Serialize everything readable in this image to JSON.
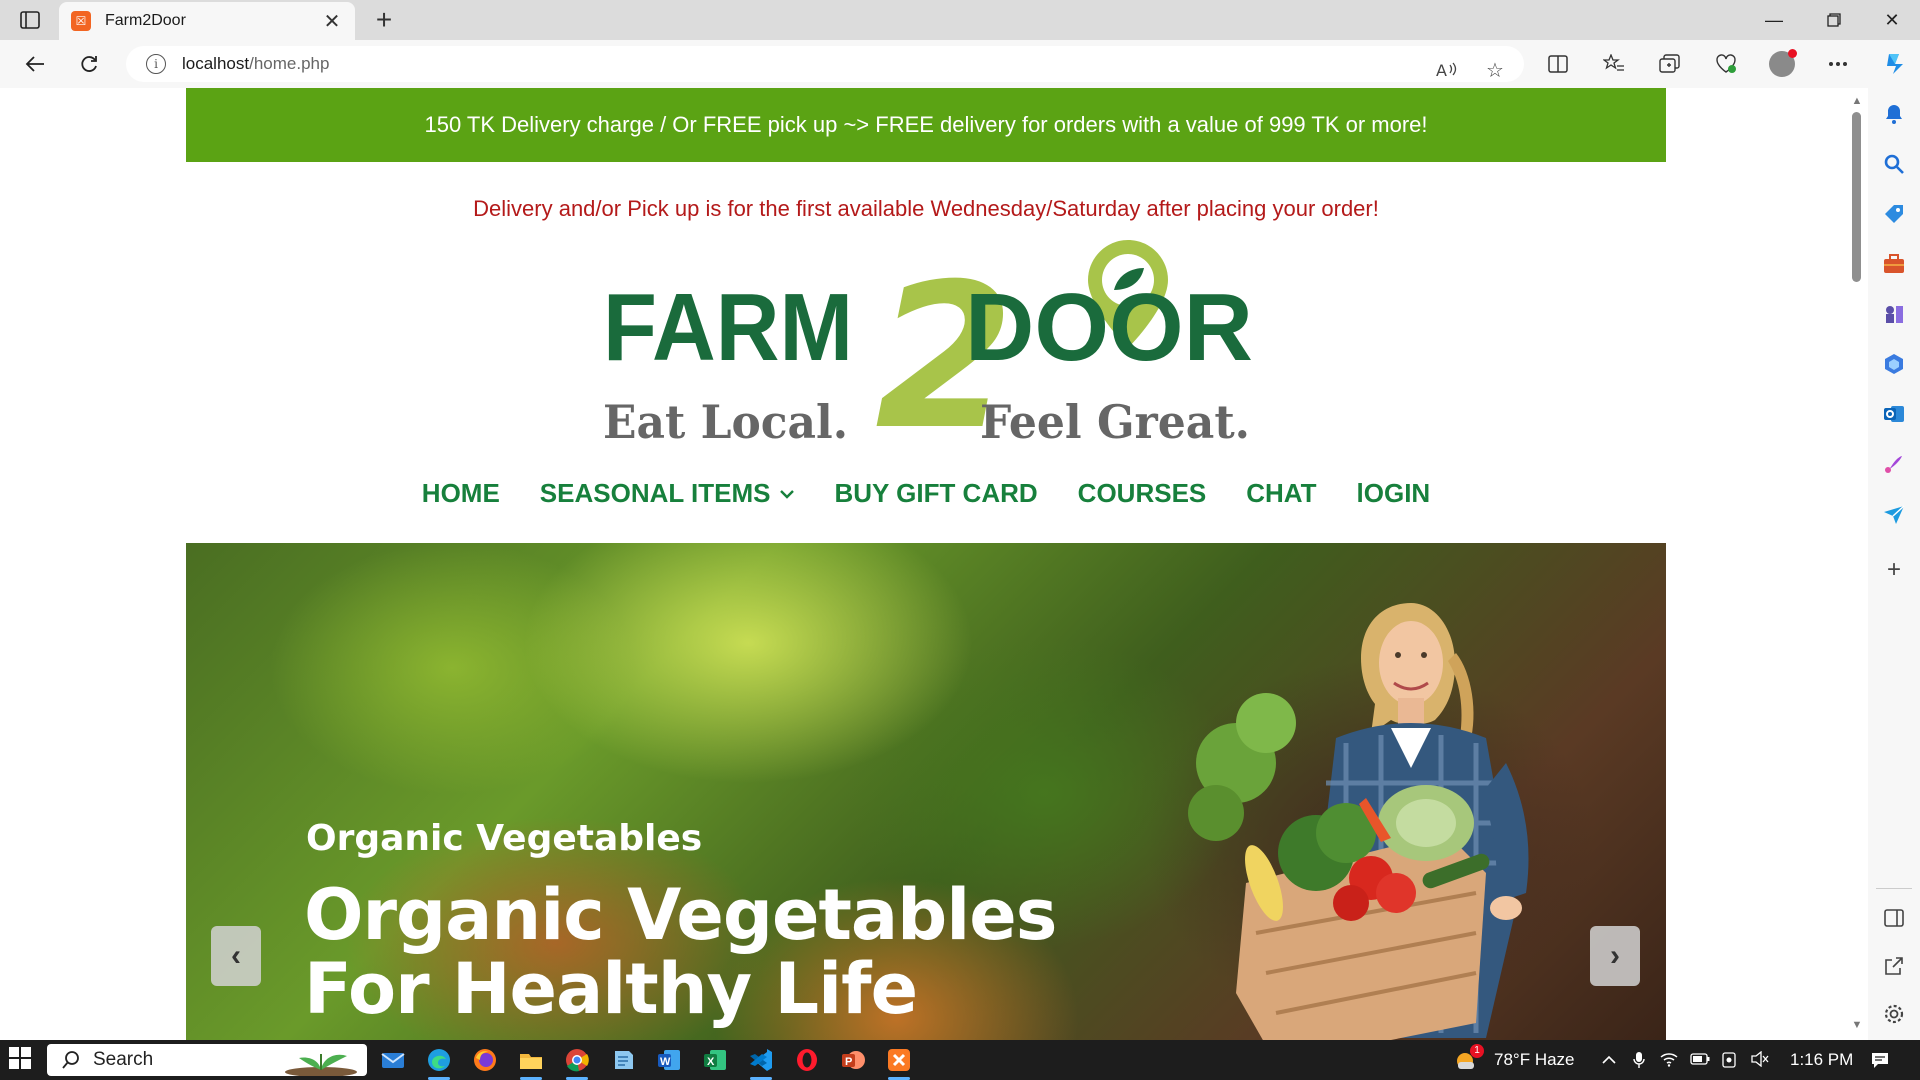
{
  "browser": {
    "tab_title": "Farm2Door",
    "url_host": "localhost",
    "url_path": "/home.php"
  },
  "page": {
    "promo": "150 TK Delivery charge / Or FREE pick up ~> FREE delivery for orders with a value of 999 TK or more!",
    "notice": "Delivery and/or Pick up is for the first available Wednesday/Saturday after placing your order!",
    "logo": {
      "word_left": "FARM",
      "digit": "2",
      "word_right": "DOOR",
      "tagline_left": "Eat Local.",
      "tagline_right": "Feel Great."
    },
    "nav": [
      {
        "label": "HOME"
      },
      {
        "label": "SEASONAL ITEMS"
      },
      {
        "label": "BUY GIFT CARD"
      },
      {
        "label": "COURSES"
      },
      {
        "label": "CHAT"
      },
      {
        "label": "lOGIN"
      }
    ],
    "hero": {
      "subtitle": "Organic Vegetables",
      "title_line1": "Organic Vegetables",
      "title_line2": "For Healthy Life",
      "prev": "‹",
      "next": "›"
    }
  },
  "taskbar": {
    "search_label": "Search",
    "weather": "78°F  Haze",
    "time": "1:16 PM",
    "weather_badge": "1"
  },
  "colors": {
    "promo_bg": "#5ba314",
    "notice_text": "#b41a1a",
    "nav_text": "#17803c",
    "logo_dark_green": "#1a6b3c",
    "logo_light_green": "#a8c44a",
    "logo_gray": "#666666"
  }
}
